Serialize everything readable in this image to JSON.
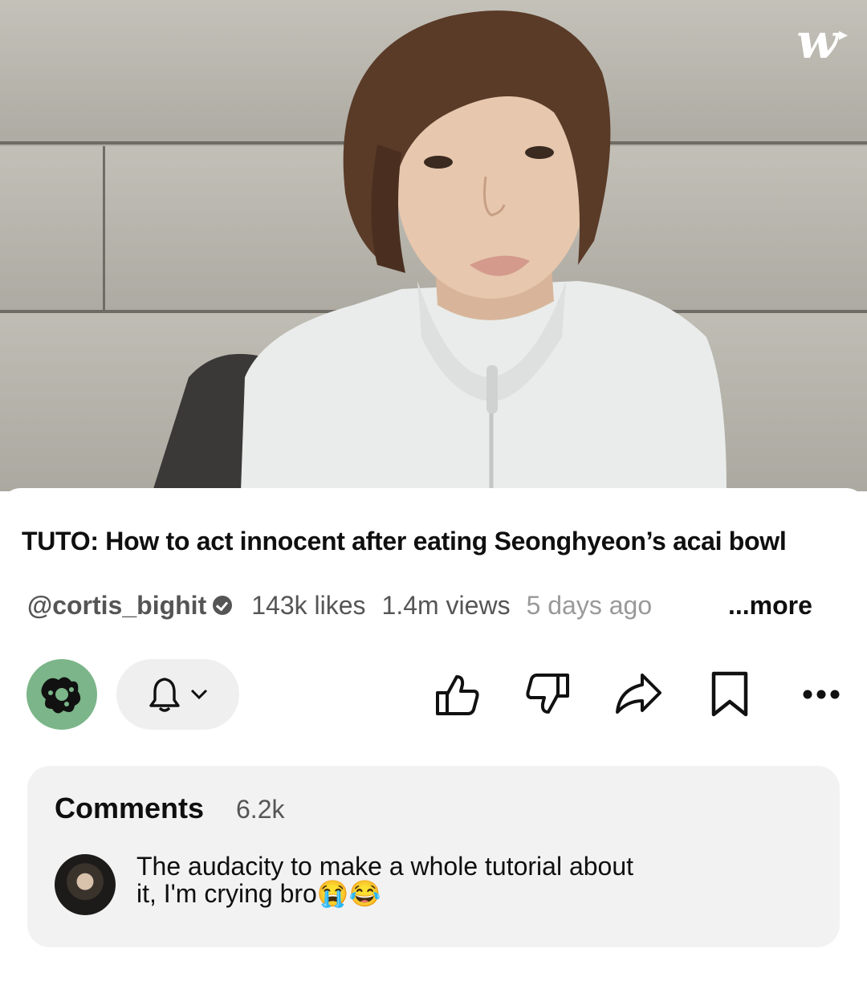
{
  "video": {
    "watermark": "w"
  },
  "title": "TUTO: How to act innocent after eating Seonghyeon’s acai bowl",
  "meta": {
    "handle": "@cortis_bighit",
    "likes": "143k likes",
    "views": "1.4m views",
    "age": "5 days ago",
    "more_label": "...more"
  },
  "actions": {
    "icons": [
      "bell-icon",
      "chevron-down-icon",
      "thumbs-up-icon",
      "thumbs-down-icon",
      "share-icon",
      "bookmark-icon",
      "more-icon"
    ]
  },
  "comments": {
    "heading": "Comments",
    "count": "6.2k",
    "top_comment": "The audacity to make a whole tutorial about it, I'm crying bro😭😂"
  },
  "colors": {
    "channel_avatar": "#7bb589",
    "card_bg": "#f2f2f2"
  }
}
